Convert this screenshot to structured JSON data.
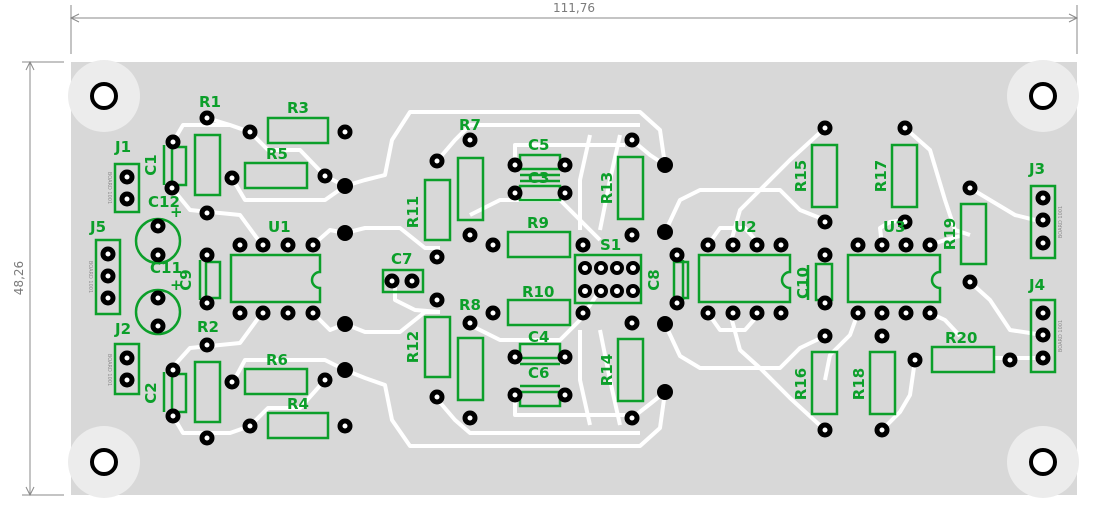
{
  "dimensions": {
    "width": "111,76",
    "height": "48,26"
  },
  "colors": {
    "board": "#d8d8d8",
    "trace": "#ffffff",
    "silkscreen": "#0c9f2a",
    "pad": "#000000",
    "dimension_line": "#8a8a8a"
  },
  "components": [
    {
      "id": "R1",
      "label": "R1"
    },
    {
      "id": "R2",
      "label": "R2"
    },
    {
      "id": "R3",
      "label": "R3"
    },
    {
      "id": "R4",
      "label": "R4"
    },
    {
      "id": "R5",
      "label": "R5"
    },
    {
      "id": "R6",
      "label": "R6"
    },
    {
      "id": "R7",
      "label": "R7"
    },
    {
      "id": "R8",
      "label": "R8"
    },
    {
      "id": "R9",
      "label": "R9"
    },
    {
      "id": "R10",
      "label": "R10"
    },
    {
      "id": "R11",
      "label": "R11"
    },
    {
      "id": "R12",
      "label": "R12"
    },
    {
      "id": "R13",
      "label": "R13"
    },
    {
      "id": "R14",
      "label": "R14"
    },
    {
      "id": "R15",
      "label": "R15"
    },
    {
      "id": "R16",
      "label": "R16"
    },
    {
      "id": "R17",
      "label": "R17"
    },
    {
      "id": "R18",
      "label": "R18"
    },
    {
      "id": "R19",
      "label": "R19"
    },
    {
      "id": "R20",
      "label": "R20"
    },
    {
      "id": "C1",
      "label": "C1"
    },
    {
      "id": "C2",
      "label": "C2"
    },
    {
      "id": "C3",
      "label": "C3"
    },
    {
      "id": "C4",
      "label": "C4"
    },
    {
      "id": "C5",
      "label": "C5"
    },
    {
      "id": "C6",
      "label": "C6"
    },
    {
      "id": "C7",
      "label": "C7"
    },
    {
      "id": "C8",
      "label": "C8"
    },
    {
      "id": "C9",
      "label": "C9"
    },
    {
      "id": "C10",
      "label": "C10"
    },
    {
      "id": "C11",
      "label": "C11"
    },
    {
      "id": "C12",
      "label": "C12"
    },
    {
      "id": "U1",
      "label": "U1"
    },
    {
      "id": "U2",
      "label": "U2"
    },
    {
      "id": "U3",
      "label": "U3"
    },
    {
      "id": "S1",
      "label": "S1"
    },
    {
      "id": "J1",
      "label": "J1"
    },
    {
      "id": "J2",
      "label": "J2"
    },
    {
      "id": "J3",
      "label": "J3"
    },
    {
      "id": "J4",
      "label": "J4"
    },
    {
      "id": "J5",
      "label": "J5"
    }
  ],
  "polarity_marks": [
    "+",
    "+"
  ],
  "connector_text": "BOARD 1001"
}
